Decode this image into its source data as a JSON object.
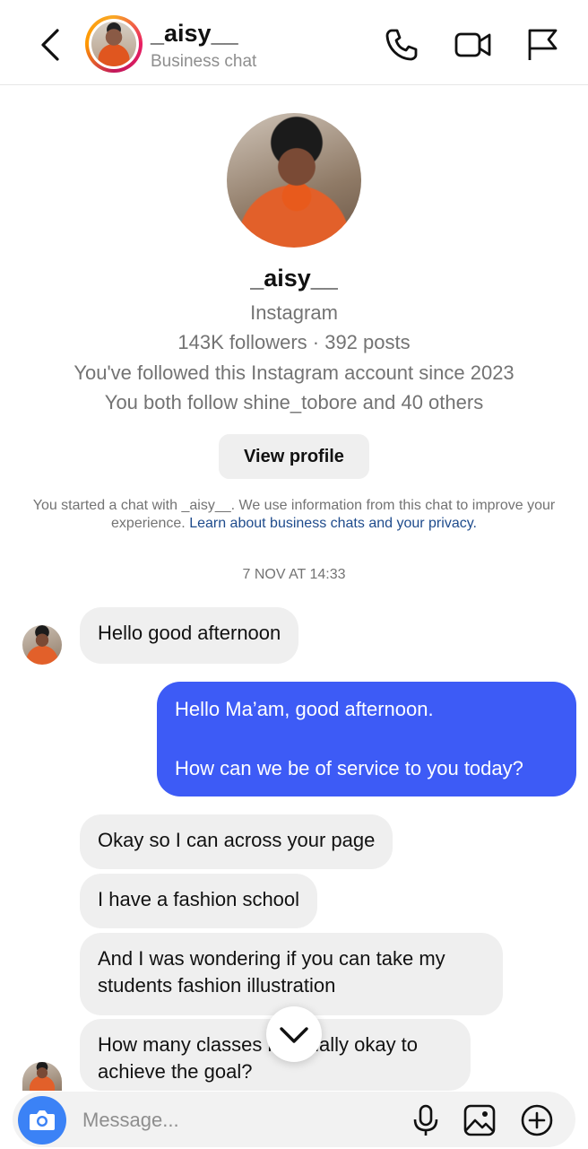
{
  "header": {
    "username": "_aisy__",
    "subtitle": "Business chat"
  },
  "icons": {
    "back": "chevron-left-icon",
    "call": "phone-icon",
    "video": "video-camera-icon",
    "report": "flag-icon"
  },
  "profile": {
    "name": "_aisy__",
    "platform": "Instagram",
    "stats": "143K followers · 392 posts",
    "followed_since": "You've followed this Instagram account since 2023",
    "mutuals": "You both follow shine_tobore and 40 others",
    "view_profile_label": "View profile"
  },
  "notice": {
    "text": "You started a chat with _aisy__. We use information from this chat to improve your experience. ",
    "link": "Learn about business chats and your privacy."
  },
  "timestamp": "7 NOV AT 14:33",
  "messages": [
    {
      "from": "them",
      "text": "Hello good afternoon"
    },
    {
      "from": "me",
      "text": "Hello Ma’am, good afternoon.\n\nHow can we be of service to you today?"
    },
    {
      "from": "them",
      "text": "Okay so I can across your page"
    },
    {
      "from": "them",
      "text": "I have a fashion school"
    },
    {
      "from": "them",
      "text": "And I was wondering if you can take my students fashion illustration"
    },
    {
      "from": "them",
      "text": "How many classes is usually okay to achieve the goal?"
    }
  ],
  "composer": {
    "placeholder": "Message..."
  },
  "colors": {
    "outgoing_bubble": "#3d5bf6",
    "incoming_bubble": "#efefef",
    "camera_button": "#3b82f6",
    "link": "#1e4b8c"
  }
}
